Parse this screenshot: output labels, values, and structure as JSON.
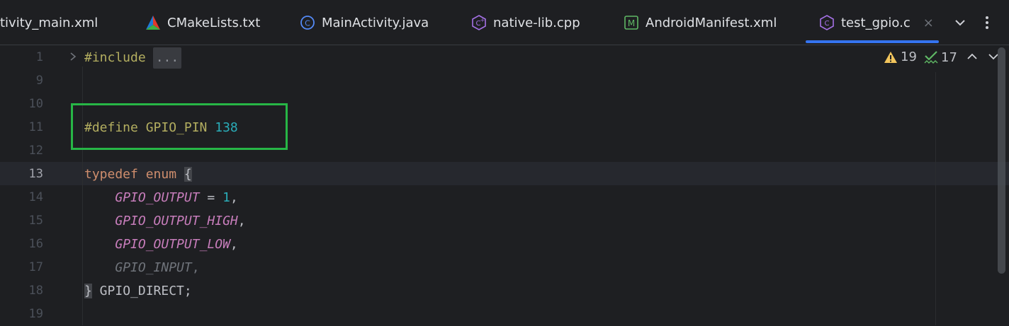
{
  "tabs": [
    {
      "label": "tivity_main.xml",
      "icon": "xml-layout-icon"
    },
    {
      "label": "CMakeLists.txt",
      "icon": "cmake-icon"
    },
    {
      "label": "MainActivity.java",
      "icon": "java-class-icon"
    },
    {
      "label": "native-lib.cpp",
      "icon": "cpp-file-icon"
    },
    {
      "label": "AndroidManifest.xml",
      "icon": "manifest-icon"
    },
    {
      "label": "test_gpio.c",
      "icon": "c-file-icon",
      "active": true
    }
  ],
  "tab_close": "×",
  "tab_more": "⌄",
  "tab_menu": "⋮",
  "inspections": {
    "warnings": "19",
    "weak_warnings": "17"
  },
  "line_numbers": [
    "1",
    "9",
    "10",
    "11",
    "12",
    "13",
    "14",
    "15",
    "16",
    "17",
    "18",
    "19"
  ],
  "active_line": "13",
  "code": {
    "l1_directive": "#include",
    "l1_folded": "...",
    "l11_directive": "#define",
    "l11_macro": "GPIO_PIN",
    "l11_value": "138",
    "l13_kw1": "typedef",
    "l13_kw2": "enum",
    "l13_brace": "{",
    "l14_name": "GPIO_OUTPUT",
    "l14_eq": " = ",
    "l14_value": "1",
    "l14_comma": ",",
    "l15_name": "GPIO_OUTPUT_HIGH",
    "l15_comma": ",",
    "l16_name": "GPIO_OUTPUT_LOW",
    "l16_comma": ",",
    "l17_name": "GPIO_INPUT",
    "l17_comma": ",",
    "l18_brace": "}",
    "l18_name": " GPIO_DIRECT;"
  },
  "colors": {
    "accent": "#3574f0",
    "highlight_box": "#27b646",
    "background": "#1e1f22"
  }
}
